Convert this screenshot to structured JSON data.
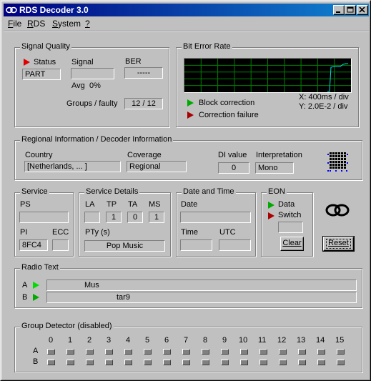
{
  "window": {
    "title": "RDS Decoder 3.0",
    "minimize": "_",
    "maximize": "□",
    "close": "✕"
  },
  "menu": [
    "File",
    "RDS",
    "System",
    "?"
  ],
  "signal_quality": {
    "label": "Signal Quality",
    "status_label": "Status",
    "status_value": "PART",
    "signal_label": "Signal",
    "signal_value": "",
    "ber_label": "BER",
    "ber_value": "-----",
    "avg_label": "Avg",
    "avg_value": "0%",
    "groups_label": "Groups / faulty",
    "groups_value": "12 / 12"
  },
  "bit_error_rate": {
    "label": "Bit Error Rate",
    "block_correction": "Block correction",
    "correction_failure": "Correction failure",
    "x_scale": "X: 400ms / div",
    "y_scale": "Y: 2.0E-2 / div"
  },
  "regional": {
    "label": "Regional Information / Decoder Information",
    "country_label": "Country",
    "country_value": "[Netherlands, ... ]",
    "coverage_label": "Coverage",
    "coverage_value": "Regional",
    "di_label": "DI value",
    "di_value": "0",
    "interp_label": "Interpretation",
    "interp_value": "Mono"
  },
  "service": {
    "label": "Service",
    "ps_label": "PS",
    "ps_value": "",
    "pi_label": "PI",
    "pi_value": "8FC4",
    "ecc_label": "ECC",
    "ecc_value": ""
  },
  "service_details": {
    "label": "Service Details",
    "la_label": "LA",
    "la_value": "",
    "tp_label": "TP",
    "tp_value": "1",
    "ta_label": "TA",
    "ta_value": "0",
    "ms_label": "MS",
    "ms_value": "1",
    "pty_label": "PTy (s)",
    "pty_value": "Pop Music"
  },
  "date_time": {
    "label": "Date and Time",
    "date_label": "Date",
    "date_value": "",
    "time_label": "Time",
    "time_value": "",
    "utc_label": "UTC",
    "utc_value": ""
  },
  "eon": {
    "label": "EON",
    "data_label": "Data",
    "switch_label": "Switch",
    "switch_value": "",
    "clear_button": "Clear"
  },
  "reset_button": "Reset",
  "radio_text": {
    "label": "Radio Text",
    "a_label": "A",
    "a_value": "Mus",
    "b_label": "B",
    "b_value": "tar9"
  },
  "group_detector": {
    "label": "Group Detector (disabled)",
    "columns": [
      "0",
      "1",
      "2",
      "3",
      "4",
      "5",
      "6",
      "7",
      "8",
      "9",
      "10",
      "11",
      "12",
      "13",
      "14",
      "15"
    ],
    "row_a": "A",
    "row_b": "B"
  },
  "colors": {
    "title_start": "#000080",
    "title_end": "#1084d0",
    "graph_bg": "#000000",
    "graph_grid": "#008000",
    "graph_line": "#00e0e0",
    "indicator_green": "#00aa00",
    "indicator_red": "#aa0000"
  }
}
